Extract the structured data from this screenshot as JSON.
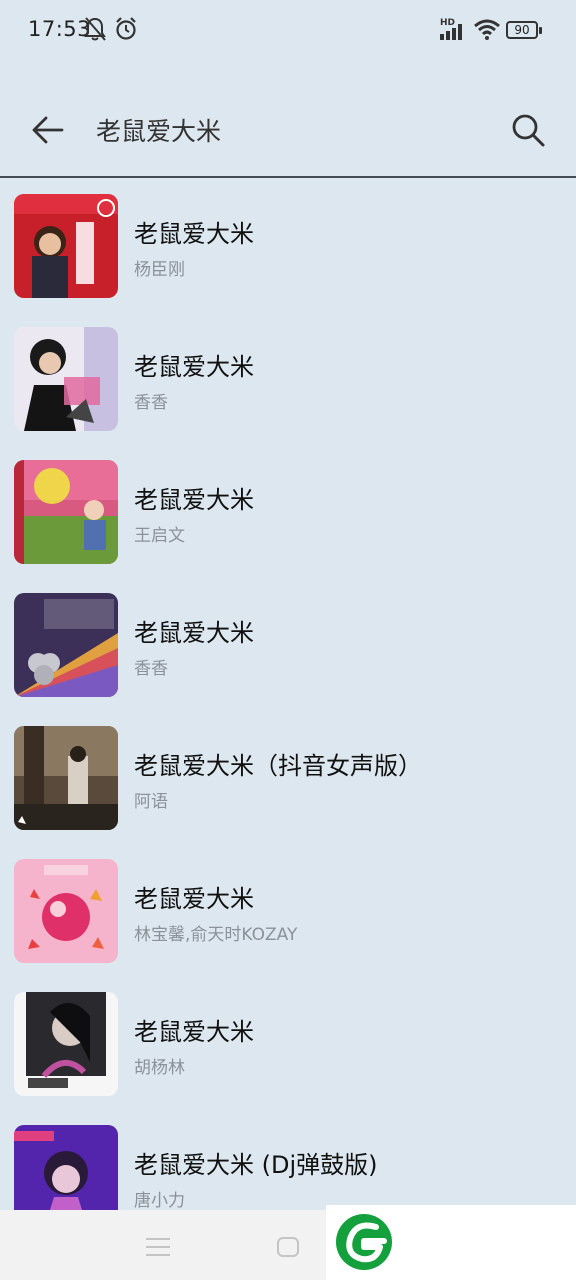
{
  "status_bar": {
    "time": "17:53",
    "battery": "90",
    "network_label": "HD"
  },
  "search": {
    "query": "老鼠爱大米"
  },
  "results": [
    {
      "title": "老鼠爱大米",
      "artist": "杨臣刚",
      "cover_color": "#c8202a"
    },
    {
      "title": "老鼠爱大米",
      "artist": "香香",
      "cover_color": "#e8e6f0"
    },
    {
      "title": "老鼠爱大米",
      "artist": "王启文",
      "cover_color": "#c84a70"
    },
    {
      "title": "老鼠爱大米",
      "artist": "香香",
      "cover_color": "#4a3a6a"
    },
    {
      "title": "老鼠爱大米（抖音女声版）",
      "artist": "阿语",
      "cover_color": "#6a5a48"
    },
    {
      "title": "老鼠爱大米",
      "artist": "林宝馨,俞天时KOZAY",
      "cover_color": "#f4aac4"
    },
    {
      "title": "老鼠爱大米",
      "artist": "胡杨林",
      "cover_color": "#f4f4f4"
    },
    {
      "title": "老鼠爱大米 (Dj弹鼓版)",
      "artist": "唐小力",
      "cover_color": "#7a3ac8"
    }
  ],
  "colors": {
    "background": "#dde7ef",
    "accent_logo": "#14a03c"
  }
}
